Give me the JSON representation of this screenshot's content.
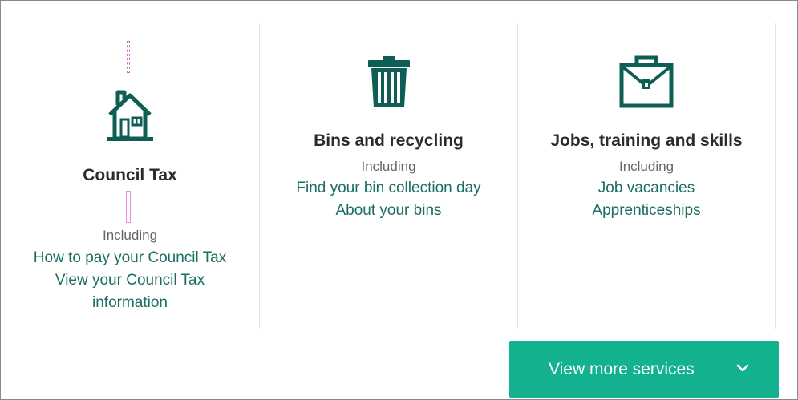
{
  "services": [
    {
      "title": "Council Tax",
      "icon": "house-icon",
      "including": "Including",
      "links": [
        "How to pay your Council Tax",
        "View your Council Tax",
        "information"
      ]
    },
    {
      "title": "Bins and recycling",
      "icon": "bin-icon",
      "including": "Including",
      "links": [
        "Find your bin collection day",
        "About your bins"
      ]
    },
    {
      "title": "Jobs, training and skills",
      "icon": "briefcase-icon",
      "including": "Including",
      "links": [
        "Job vacancies",
        "Apprenticeships"
      ]
    }
  ],
  "view_more": {
    "label": "View more services",
    "icon": "chevron-down-icon"
  },
  "colors": {
    "brand": "#0e5e56",
    "link": "#1a6e62",
    "button": "#14b18f"
  }
}
